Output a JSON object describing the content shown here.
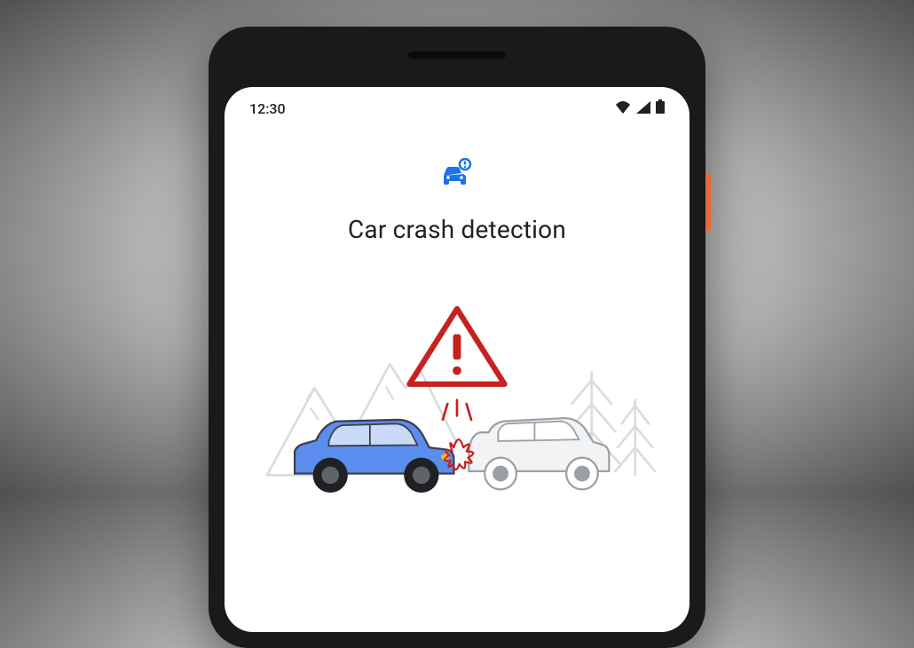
{
  "statusBar": {
    "time": "12:30"
  },
  "content": {
    "title": "Car crash detection"
  },
  "icons": {
    "wifi": "wifi-icon",
    "signal": "signal-icon",
    "battery": "battery-icon",
    "carAlert": "car-alert-icon",
    "warning": "warning-triangle-icon"
  }
}
